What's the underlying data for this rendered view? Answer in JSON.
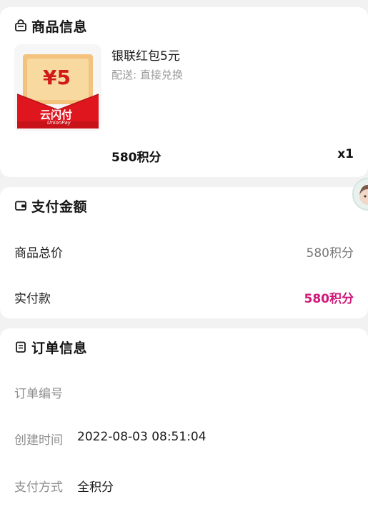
{
  "goods": {
    "section_title": "商品信息",
    "section_icon": "bag-icon",
    "name": "银联红包5元",
    "delivery": "配送: 直接兑换",
    "price": "580积分",
    "quantity": "x1",
    "image": {
      "amount": "¥5",
      "brand_cn": "云闪付",
      "brand_en": "UnionPay"
    }
  },
  "payment": {
    "section_title": "支付金额",
    "section_icon": "wallet-icon",
    "rows": [
      {
        "label": "商品总价",
        "value": "580积分"
      },
      {
        "label": "实付款",
        "value": "580积分",
        "accent": "#d0187a"
      }
    ]
  },
  "order": {
    "section_title": "订单信息",
    "section_icon": "order-list-icon",
    "rows": [
      {
        "label": "订单编号",
        "value": ""
      },
      {
        "label": "创建时间",
        "value": "2022-08-03 08:51:04"
      },
      {
        "label": "支付方式",
        "value": "全积分"
      }
    ]
  },
  "floating": {
    "icon": "customer-service-avatar-icon"
  }
}
